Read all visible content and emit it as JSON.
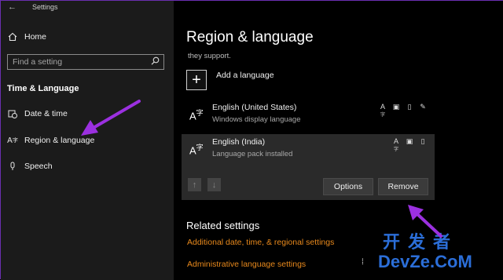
{
  "window": {
    "title": "Settings",
    "controls": {
      "minimize": "—",
      "maximize": "☐",
      "close": "✕"
    }
  },
  "sidebar": {
    "home_label": "Home",
    "search_placeholder": "Find a setting",
    "section_title": "Time & Language",
    "items": [
      {
        "label": "Date & time",
        "icon": "calendar-clock-icon"
      },
      {
        "label": "Region & language",
        "icon": "region-language-icon"
      },
      {
        "label": "Speech",
        "icon": "microphone-icon"
      }
    ]
  },
  "main": {
    "title": "Region & language",
    "support_text": "they support.",
    "add_language_label": "Add a language",
    "languages": [
      {
        "name": "English (United States)",
        "status": "Windows display language"
      },
      {
        "name": "English (India)",
        "status": "Language pack installed"
      }
    ],
    "options_label": "Options",
    "remove_label": "Remove",
    "related_title": "Related settings",
    "links": [
      "Additional date, time, & regional settings",
      "Administrative language settings"
    ]
  },
  "watermark": {
    "cn": "开发者",
    "en": "DevZe.CoM"
  },
  "colors": {
    "accent_link": "#e8891c",
    "annotation_arrow": "#9b30e0",
    "window_border": "#6a2fb0"
  }
}
